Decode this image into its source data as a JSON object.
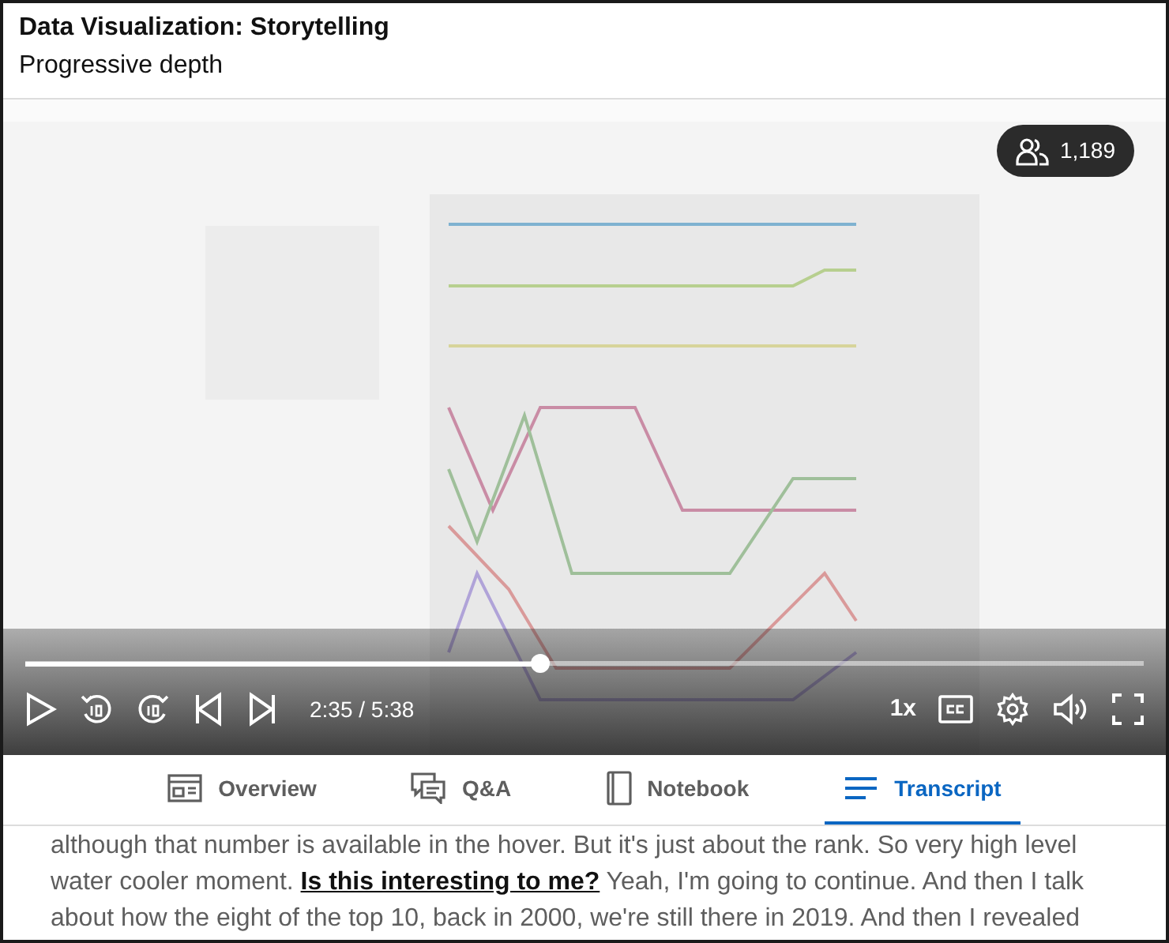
{
  "header": {
    "course_title": "Data Visualization: Storytelling",
    "video_title": "Progressive depth"
  },
  "player": {
    "viewers": "1,189",
    "progress": {
      "level": 0.46
    },
    "time": "2:35 / 5:38",
    "speed": "1x"
  },
  "tabs": [
    {
      "label": "Overview",
      "kind": "overview",
      "selected": false
    },
    {
      "label": "Q&A",
      "kind": "qa",
      "selected": false
    },
    {
      "label": "Notebook",
      "kind": "notebook",
      "selected": false
    },
    {
      "label": "Transcript",
      "kind": "transcript",
      "selected": true
    }
  ],
  "transcript": {
    "before": "although that number is available in the hover. But it's just about the rank. So very high level water cooler moment. ",
    "link": "Is this interesting to me?",
    "after": " Yeah, I'm going to continue. And then I talk about how the eight of the top 10, back in 2000, we're still there in 2019. And then I revealed"
  }
}
